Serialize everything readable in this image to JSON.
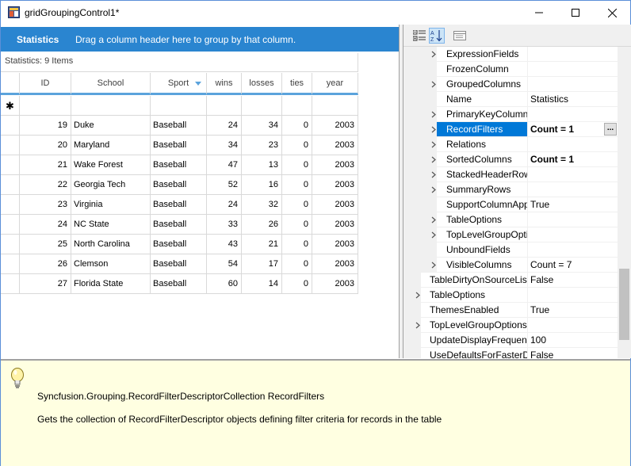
{
  "window": {
    "title": "gridGroupingControl1*"
  },
  "group_drop_area": {
    "title": "Statistics",
    "hint": "Drag a column header here to group by that column."
  },
  "grid": {
    "caption": "Statistics: 9 Items",
    "columns": [
      "ID",
      "School",
      "Sport",
      "wins",
      "losses",
      "ties",
      "year"
    ],
    "add_new_marker": "✱",
    "rows": [
      {
        "id": "19",
        "school": "Duke",
        "sport": "Baseball",
        "wins": "24",
        "losses": "34",
        "ties": "0",
        "year": "2003"
      },
      {
        "id": "20",
        "school": "Maryland",
        "sport": "Baseball",
        "wins": "34",
        "losses": "23",
        "ties": "0",
        "year": "2003"
      },
      {
        "id": "21",
        "school": "Wake Forest",
        "sport": "Baseball",
        "wins": "47",
        "losses": "13",
        "ties": "0",
        "year": "2003"
      },
      {
        "id": "22",
        "school": "Georgia Tech",
        "sport": "Baseball",
        "wins": "52",
        "losses": "16",
        "ties": "0",
        "year": "2003"
      },
      {
        "id": "23",
        "school": "Virginia",
        "sport": "Baseball",
        "wins": "24",
        "losses": "32",
        "ties": "0",
        "year": "2003"
      },
      {
        "id": "24",
        "school": "NC State",
        "sport": "Baseball",
        "wins": "33",
        "losses": "26",
        "ties": "0",
        "year": "2003"
      },
      {
        "id": "25",
        "school": "North Carolina",
        "sport": "Baseball",
        "wins": "43",
        "losses": "21",
        "ties": "0",
        "year": "2003"
      },
      {
        "id": "26",
        "school": "Clemson",
        "sport": "Baseball",
        "wins": "54",
        "losses": "17",
        "ties": "0",
        "year": "2003"
      },
      {
        "id": "27",
        "school": "Florida State",
        "sport": "Baseball",
        "wins": "60",
        "losses": "14",
        "ties": "0",
        "year": "2003"
      }
    ]
  },
  "property_grid": {
    "rows": [
      {
        "name": "ExpressionFields",
        "value": "",
        "expandable": true,
        "nested": true
      },
      {
        "name": "FrozenColumn",
        "value": "",
        "expandable": false,
        "nested": true
      },
      {
        "name": "GroupedColumns",
        "value": "",
        "expandable": true,
        "nested": true
      },
      {
        "name": "Name",
        "value": "Statistics",
        "expandable": false,
        "nested": true
      },
      {
        "name": "PrimaryKeyColumns",
        "value": "",
        "expandable": true,
        "nested": true
      },
      {
        "name": "RecordFilters",
        "value": "Count = 1",
        "expandable": true,
        "nested": true,
        "selected": true,
        "bold": true,
        "ellipsis": "..."
      },
      {
        "name": "Relations",
        "value": "",
        "expandable": true,
        "nested": true
      },
      {
        "name": "SortedColumns",
        "value": "Count = 1",
        "expandable": true,
        "nested": true,
        "bold": true
      },
      {
        "name": "StackedHeaderRows",
        "value": "",
        "expandable": true,
        "nested": true
      },
      {
        "name": "SummaryRows",
        "value": "",
        "expandable": true,
        "nested": true
      },
      {
        "name": "SupportColumnApply",
        "value": "True",
        "expandable": false,
        "nested": true
      },
      {
        "name": "TableOptions",
        "value": "",
        "expandable": true,
        "nested": true
      },
      {
        "name": "TopLevelGroupOptions",
        "value": "",
        "expandable": true,
        "nested": true
      },
      {
        "name": "UnboundFields",
        "value": "",
        "expandable": false,
        "nested": true
      },
      {
        "name": "VisibleColumns",
        "value": "Count = 7",
        "expandable": true,
        "nested": true
      },
      {
        "name": "TableDirtyOnSourceListChange",
        "value": "False",
        "expandable": false,
        "nested": false
      },
      {
        "name": "TableOptions",
        "value": "",
        "expandable": true,
        "nested": false
      },
      {
        "name": "ThemesEnabled",
        "value": "True",
        "expandable": false,
        "nested": false
      },
      {
        "name": "TopLevelGroupOptions",
        "value": "",
        "expandable": true,
        "nested": false
      },
      {
        "name": "UpdateDisplayFrequency",
        "value": "100",
        "expandable": false,
        "nested": false
      },
      {
        "name": "UseDefaultsForFasterDrawing",
        "value": "False",
        "expandable": false,
        "nested": false
      }
    ]
  },
  "help": {
    "title": "Syncfusion.Grouping.RecordFilterDescriptorCollection RecordFilters",
    "description": "Gets the collection of RecordFilterDescriptor objects defining filter criteria for records in the table"
  },
  "colors": {
    "accent": "#2a85d0",
    "header_underline": "#5ba3dc",
    "selection": "#0078d7",
    "help_background": "#ffffe1"
  }
}
